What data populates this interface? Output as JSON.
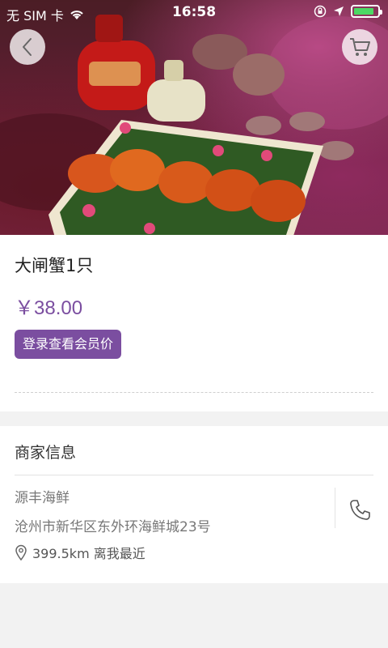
{
  "status_bar": {
    "carrier": "无 SIM 卡",
    "time": "16:58"
  },
  "product": {
    "name": "大闸蟹1只",
    "price": "￥38.00",
    "member_button": "登录查看会员价"
  },
  "merchant": {
    "section_title": "商家信息",
    "name": "源丰海鲜",
    "address": "沧州市新华区东外环海鲜城23号",
    "distance": "399.5km 离我最近"
  },
  "colors": {
    "accent": "#7b4ea0",
    "battery": "#4cd964"
  },
  "icons": [
    "back-arrow-icon",
    "cart-icon",
    "wifi-icon",
    "location-arrow-icon",
    "rotation-lock-icon",
    "battery-icon",
    "location-pin-icon",
    "phone-icon"
  ]
}
